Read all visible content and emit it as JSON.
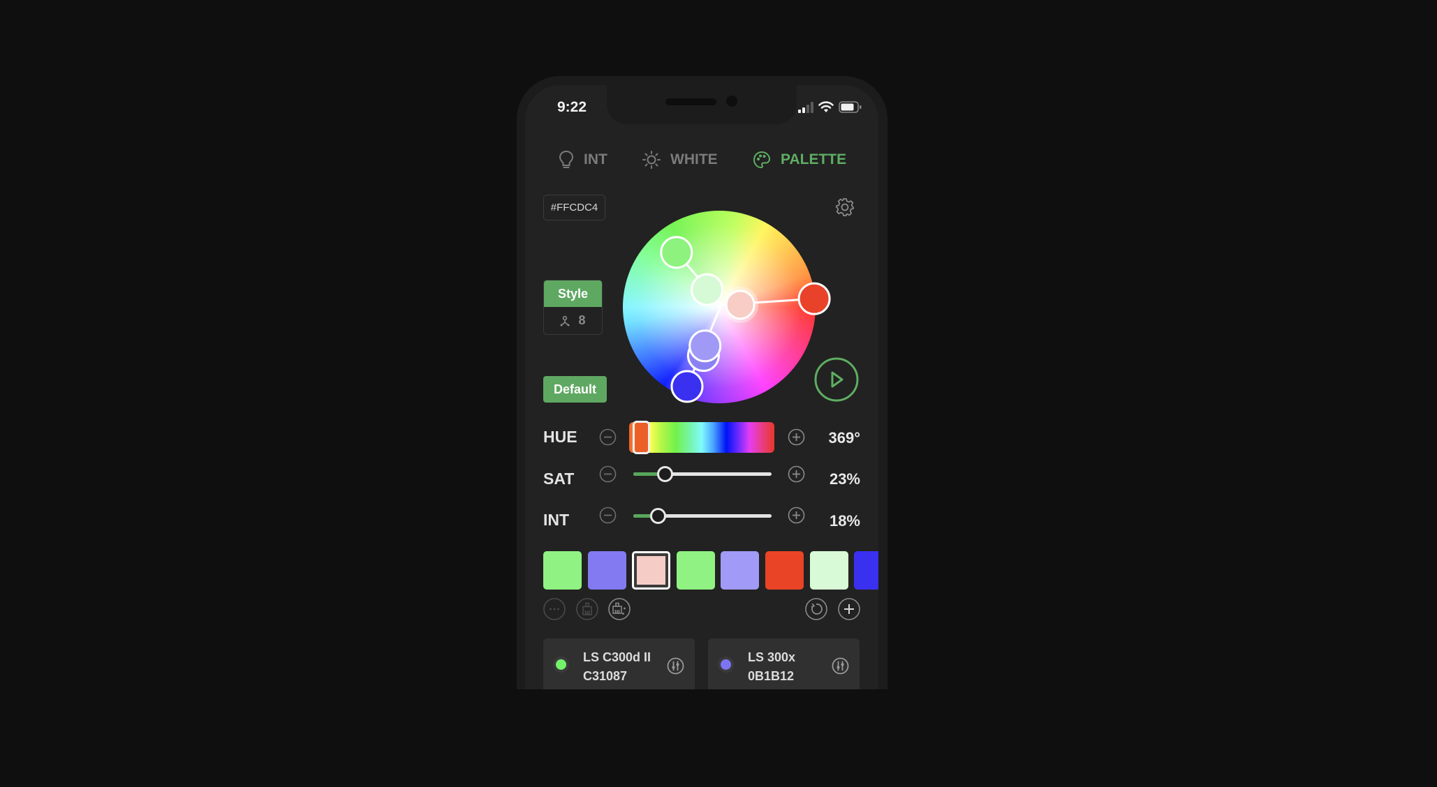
{
  "status_bar": {
    "time": "9:22",
    "icons": [
      "cellular-signal-icon",
      "wifi-icon",
      "battery-icon"
    ]
  },
  "tabs": [
    {
      "label": "INT",
      "icon": "lightbulb-icon",
      "active": false
    },
    {
      "label": "WHITE",
      "icon": "sun-icon",
      "active": false
    },
    {
      "label": "PALETTE",
      "icon": "palette-icon",
      "active": true
    }
  ],
  "hex_value": "#FFCDC4",
  "style": {
    "label": "Style",
    "count": "8",
    "icon": "tripod-icon"
  },
  "default_label": "Default",
  "colors": {
    "accent": "#5FAE62",
    "background": "#222222"
  },
  "wheel": {
    "handles": [
      {
        "name": "red",
        "color": "#E8432A",
        "hue_deg": 5,
        "saturation": 0.99
      },
      {
        "name": "pink-selected",
        "color": "#F7CDC6",
        "hue_deg": 6,
        "saturation": 0.22,
        "selected": true
      },
      {
        "name": "light-green",
        "color": "#D6FAD6",
        "hue_deg": 125,
        "saturation": 0.22
      },
      {
        "name": "green",
        "color": "#8DF27E",
        "hue_deg": 128,
        "saturation": 0.72
      },
      {
        "name": "lavender",
        "color": "#A09AF6",
        "hue_deg": 250,
        "saturation": 0.43
      },
      {
        "name": "purple",
        "color": "#8B82F2",
        "hue_deg": 252,
        "saturation": 0.53
      },
      {
        "name": "blue",
        "color": "#3A30F0",
        "hue_deg": 248,
        "saturation": 0.89
      }
    ]
  },
  "sliders": {
    "hue": {
      "label": "HUE",
      "value_text": "369°",
      "value": 369,
      "max": 360
    },
    "sat": {
      "label": "SAT",
      "value_text": "23%",
      "value": 23
    },
    "int": {
      "label": "INT",
      "value_text": "18%",
      "value": 18
    }
  },
  "swatches": [
    {
      "color": "#8FF282",
      "selected": false
    },
    {
      "color": "#8379F0",
      "selected": false
    },
    {
      "color": "#F6CDC6",
      "selected": true
    },
    {
      "color": "#8FF282",
      "selected": false
    },
    {
      "color": "#A19AF6",
      "selected": false
    },
    {
      "color": "#E84425",
      "selected": false
    },
    {
      "color": "#D8FAD7",
      "selected": false
    },
    {
      "color": "#3A30F0",
      "selected": false
    }
  ],
  "palette_actions": {
    "left": [
      "more-icon",
      "brush-icon",
      "magic-brush-icon"
    ],
    "right": [
      "reset-icon",
      "add-icon"
    ]
  },
  "devices": [
    {
      "name": "LS C300d II",
      "id": "C31087",
      "dot_color": "#73F26A"
    },
    {
      "name": "LS 300x",
      "id": "0B1B12",
      "dot_color": "#7E74F2"
    }
  ]
}
